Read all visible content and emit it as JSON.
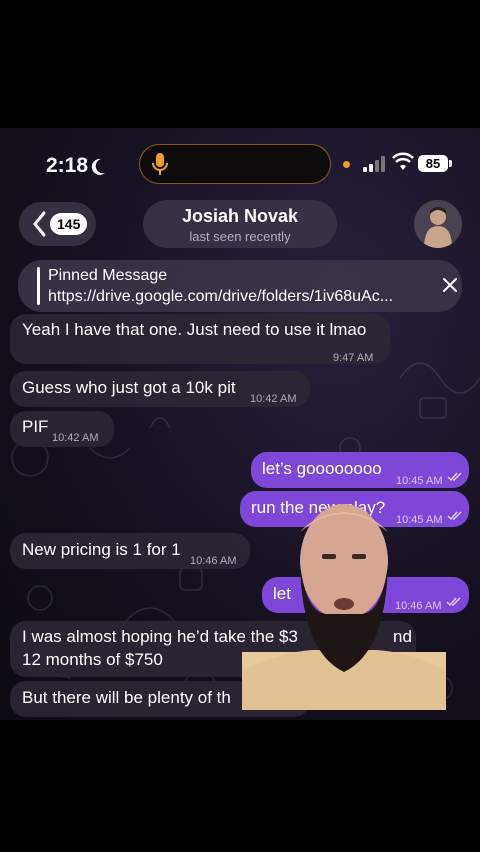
{
  "status_bar": {
    "time": "2:18",
    "battery": "85"
  },
  "header": {
    "back_count": "145",
    "name": "Josiah Novak",
    "status": "last seen recently"
  },
  "pinned": {
    "title": "Pinned Message",
    "url": "https://drive.google.com/drive/folders/1iv68uAc..."
  },
  "messages": [
    {
      "dir": "in",
      "text": "Yeah I have that one. Just need to use it lmao",
      "time": "9:47 AM"
    },
    {
      "dir": "in",
      "text": "Guess who just got a 10k pit",
      "time": "10:42 AM"
    },
    {
      "dir": "in",
      "text": "PIF",
      "time": "10:42 AM"
    },
    {
      "dir": "out",
      "text": "let’s goooooooo",
      "time": "10:45 AM"
    },
    {
      "dir": "out",
      "text": "run the new play?",
      "time": "10:45 AM"
    },
    {
      "dir": "in",
      "text": "New pricing is 1 for 1",
      "time": "10:46 AM"
    },
    {
      "dir": "out",
      "text": "let",
      "time": "10:46 AM"
    },
    {
      "dir": "in",
      "line1": "I was almost hoping he’d take the $3",
      "line1_end": "nd",
      "line2": "12 months of $750"
    },
    {
      "dir": "in",
      "text": "But there will be plenty of th"
    }
  ],
  "colors": {
    "outgoing": "#7e47d8",
    "incoming": "#2c2634",
    "accent": "#f0a020"
  },
  "icons": [
    "moon-icon",
    "microphone-icon",
    "cellular-signal-icon",
    "wifi-icon",
    "battery-icon",
    "back-chevron-icon",
    "close-icon",
    "double-check-icon"
  ]
}
